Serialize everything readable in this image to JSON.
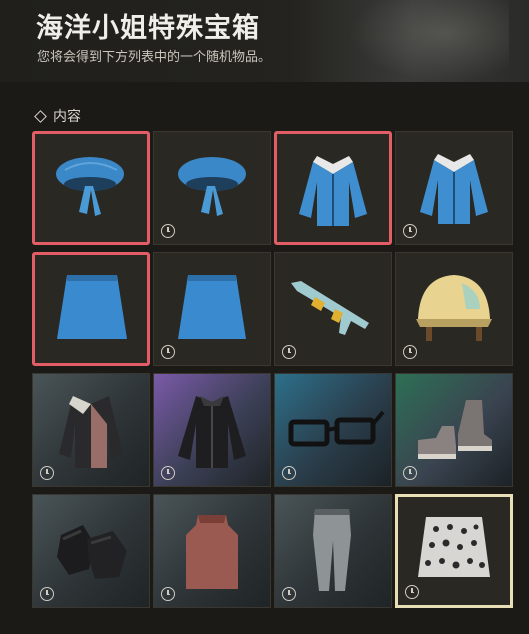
{
  "header": {
    "title": "海洋小姐特殊宝箱",
    "subtitle": "您将会得到下方列表中的一个随机物品。"
  },
  "section": {
    "label": "内容"
  },
  "colors": {
    "selected_border": "#e35d66",
    "special_border": "#e9dfb6",
    "tile_bg": "#2a2823"
  },
  "items": [
    {
      "name": "blue-beret-item",
      "icon": "beret-icon",
      "state": "selected",
      "clock": false
    },
    {
      "name": "blue-beret-item-timed",
      "icon": "beret-icon",
      "state": "normal",
      "clock": true
    },
    {
      "name": "blue-jacket-item",
      "icon": "jacket-icon",
      "state": "selected",
      "clock": false
    },
    {
      "name": "blue-jacket-item-timed",
      "icon": "jacket-icon",
      "state": "normal",
      "clock": true
    },
    {
      "name": "blue-skirt-item",
      "icon": "skirt-icon",
      "state": "selected",
      "clock": false
    },
    {
      "name": "blue-skirt-item-timed",
      "icon": "skirt-icon",
      "state": "normal",
      "clock": true
    },
    {
      "name": "rifle-skin-item",
      "icon": "rifle-icon",
      "state": "normal",
      "clock": true
    },
    {
      "name": "helmet-skin-item",
      "icon": "helmet-icon",
      "state": "normal",
      "clock": true
    },
    {
      "name": "leather-jacket-item",
      "icon": "leather-jacket-icon",
      "state": "normal",
      "clock": true
    },
    {
      "name": "black-jacket-item",
      "icon": "black-jacket-icon",
      "state": "normal",
      "clock": true
    },
    {
      "name": "glasses-item",
      "icon": "glasses-icon",
      "state": "normal",
      "clock": true
    },
    {
      "name": "sneakers-item",
      "icon": "sneakers-icon",
      "state": "normal",
      "clock": true
    },
    {
      "name": "gloves-item",
      "icon": "gloves-icon",
      "state": "normal",
      "clock": true
    },
    {
      "name": "vest-item",
      "icon": "vest-icon",
      "state": "normal",
      "clock": true
    },
    {
      "name": "pants-item",
      "icon": "pants-icon",
      "state": "normal",
      "clock": true
    },
    {
      "name": "leopard-skirt-item",
      "icon": "leopard-skirt-icon",
      "state": "special",
      "clock": true
    }
  ]
}
